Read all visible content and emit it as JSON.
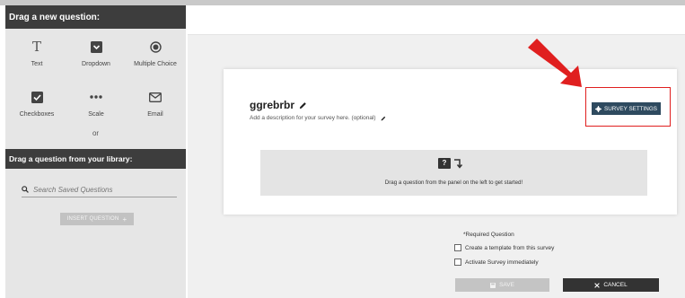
{
  "left_panel": {
    "new_question_header": "Drag a new question:",
    "question_types": [
      {
        "label": "Text",
        "icon": "text-icon"
      },
      {
        "label": "Dropdown",
        "icon": "dropdown-icon"
      },
      {
        "label": "Multiple Choice",
        "icon": "radio-icon"
      },
      {
        "label": "Checkboxes",
        "icon": "checkbox-icon"
      },
      {
        "label": "Scale",
        "icon": "scale-icon"
      },
      {
        "label": "Email",
        "icon": "email-icon"
      }
    ],
    "or_label": "or",
    "library_header": "Drag a question from your library:",
    "search_placeholder": "Search Saved Questions",
    "insert_button": "INSERT QUESTION",
    "insert_button_icon": "+"
  },
  "survey": {
    "title": "ggrebrbr",
    "description": "Add a description for your survey here. (optional)",
    "settings_button": "SURVEY SETTINGS",
    "dropzone_text": "Drag a question from the panel on the left to get started!"
  },
  "footer": {
    "required_label": "*Required Question",
    "template_checkbox_label": "Create a template from this survey",
    "activate_checkbox_label": "Activate Survey immediately",
    "save_button": "SAVE",
    "cancel_button": "CANCEL"
  },
  "colors": {
    "accent_highlight": "#e01f1f",
    "settings_button_bg": "#2e4a5f",
    "panel_header_bg": "#3d3d3d"
  }
}
